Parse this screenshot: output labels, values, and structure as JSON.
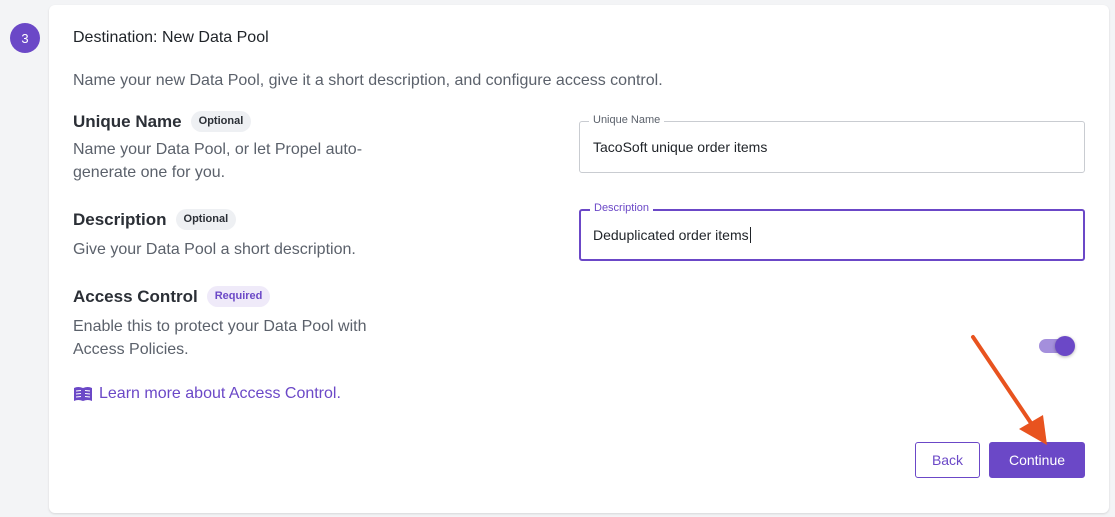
{
  "step": {
    "number": "3"
  },
  "card": {
    "title": "Destination: New Data Pool",
    "intro": "Name your new Data Pool, give it a short description, and configure access control."
  },
  "unique_name": {
    "label": "Unique Name",
    "badge": "Optional",
    "description": "Name your Data Pool, or let Propel auto-generate one for you.",
    "field_legend": "Unique Name",
    "field_value": "TacoSoft unique order items"
  },
  "description_section": {
    "label": "Description",
    "badge": "Optional",
    "description": "Give your Data Pool a short description.",
    "field_legend": "Description",
    "field_value": "Deduplicated order items"
  },
  "access_control": {
    "label": "Access Control",
    "badge": "Required",
    "description": "Enable this to protect your Data Pool with Access Policies.",
    "toggle_state": "on"
  },
  "learn_more": {
    "icon": "book-icon",
    "text": "Learn more about Access Control."
  },
  "actions": {
    "back_label": "Back",
    "continue_label": "Continue"
  },
  "colors": {
    "accent": "#6b48c7",
    "annotation_arrow": "#e8531f"
  }
}
